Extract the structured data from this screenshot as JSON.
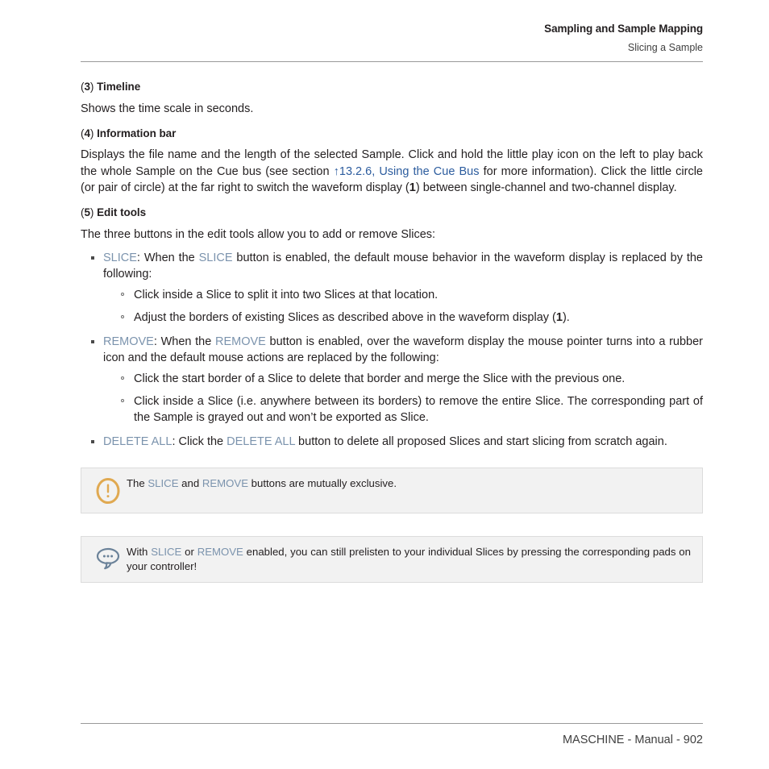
{
  "colors": {
    "link": "#2c5c9e",
    "keyword": "#7b93ad",
    "warn_icon": "#e0a951",
    "tip_icon": "#6b8299",
    "callout_bg": "#f2f2f2",
    "text": "#231f20"
  },
  "header": {
    "title": "Sampling and Sample Mapping",
    "subtitle": "Slicing a Sample"
  },
  "sections": {
    "timeline": {
      "paren_open": "(",
      "number": "3",
      "paren_close": ")",
      "heading": "Timeline",
      "body": "Shows the time scale in seconds."
    },
    "information_bar": {
      "paren_open": "(",
      "number": "4",
      "paren_close": ")",
      "heading": "Information bar",
      "body_part1": "Displays the file name and the length of the selected Sample. Click and hold the little play icon on the left to play back the whole Sample on the Cue bus (see section ",
      "link_text": "↑13.2.6, Using the Cue Bus",
      "body_part2": " for more information). Click the little circle (or pair of circle) at the far right to switch the waveform display (",
      "bold_ref": "1",
      "body_part3": ") between single-channel and two-channel display."
    },
    "edit_tools": {
      "paren_open": "(",
      "number": "5",
      "paren_close": ")",
      "heading": "Edit tools",
      "body": "The three buttons in the edit tools allow you to add or remove Slices:"
    }
  },
  "bullets": {
    "slice": {
      "keyword": "SLICE",
      "text_part1": ": When the ",
      "keyword2": "SLICE",
      "text_part2": " button is enabled, the default mouse behavior in the waveform display is replaced by the following:",
      "sub": [
        {
          "text": "Click inside a Slice to split it into two Slices at that location."
        },
        {
          "text_part1": "Adjust the borders of existing Slices as described above in the waveform display (",
          "bold_ref": "1",
          "text_part2": ")."
        }
      ]
    },
    "remove": {
      "keyword": "REMOVE",
      "text_part1": ": When the ",
      "keyword2": "REMOVE",
      "text_part2": " button is enabled, over the waveform display the mouse pointer turns into a rubber icon and the default mouse actions are replaced by the following:",
      "sub": [
        {
          "text": "Click the start border of a Slice to delete that border and merge the Slice with the previous one."
        },
        {
          "text": "Click inside a Slice (i.e. anywhere between its borders) to remove the entire Slice. The corresponding part of the Sample is grayed out and won’t be exported as Slice."
        }
      ]
    },
    "delete_all": {
      "keyword": "DELETE ALL",
      "text_part1": ": Click the ",
      "keyword2": "DELETE ALL",
      "text_part2": " button to delete all proposed Slices and start slicing from scratch again."
    }
  },
  "callouts": {
    "warning": {
      "icon": "exclamation-circle-icon",
      "text_part1": "The ",
      "keyword1": "SLICE",
      "text_part2": " and ",
      "keyword2": "REMOVE",
      "text_part3": " buttons are mutually exclusive."
    },
    "tip": {
      "icon": "speech-bubble-icon",
      "text_part1": "With ",
      "keyword1": "SLICE",
      "text_part2": " or ",
      "keyword2": "REMOVE",
      "text_part3": " enabled, you can still prelisten to your individual Slices by pressing the corresponding pads on your controller!"
    }
  },
  "footer": {
    "text": "MASCHINE - Manual - 902"
  }
}
